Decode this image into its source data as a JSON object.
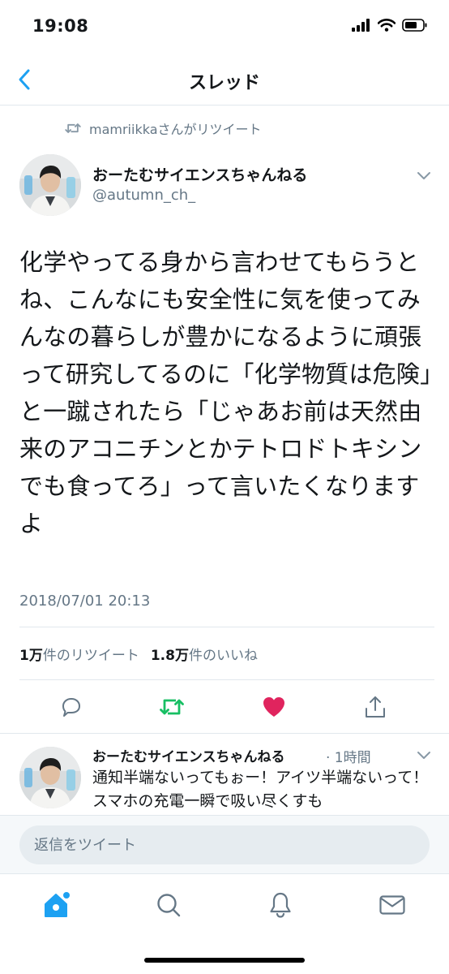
{
  "status_bar": {
    "time": "19:08"
  },
  "nav": {
    "title": "スレッド"
  },
  "retweet_context": {
    "text": "mamriikkaさんがリツイート"
  },
  "tweet": {
    "author_name": "おーたむサイエンスちゃんねる",
    "author_handle": "@autumn_ch_",
    "text": "化学やってる身から言わせてもらうとね、こんなにも安全性に気を使ってみんなの暮らしが豊かになるように頑張って研究してるのに「化学物質は危険」と一蹴されたら「じゃあお前は天然由来のアコニチンとかテトロドトキシンでも食ってろ」って言いたくなりますよ",
    "timestamp": "2018/07/01 20:13",
    "retweet_count": "1万",
    "retweet_label": "件のリツイート",
    "like_count": "1.8万",
    "like_label": "件のいいね"
  },
  "reply_preview": {
    "author_name": "おーたむサイエンスちゃんねる",
    "time": "· 1時間",
    "text": "通知半端ないってもぉー！アイツ半端ないって！スマホの充電一瞬で吸い尽くすも"
  },
  "reply_box": {
    "placeholder": "返信をツイート"
  },
  "colors": {
    "accent": "#1da1f2",
    "retweet_green": "#17bf63",
    "like_red": "#e0245e",
    "secondary_text": "#657786"
  },
  "icons": {
    "back": "chevron-left-icon",
    "caret": "chevron-down-icon",
    "retweet_context": "retweet-icon",
    "reply": "reply-icon",
    "retweet": "retweet-icon",
    "like": "heart-icon",
    "share": "share-icon",
    "home": "home-icon",
    "search": "search-icon",
    "notifications": "bell-icon",
    "messages": "envelope-icon"
  }
}
